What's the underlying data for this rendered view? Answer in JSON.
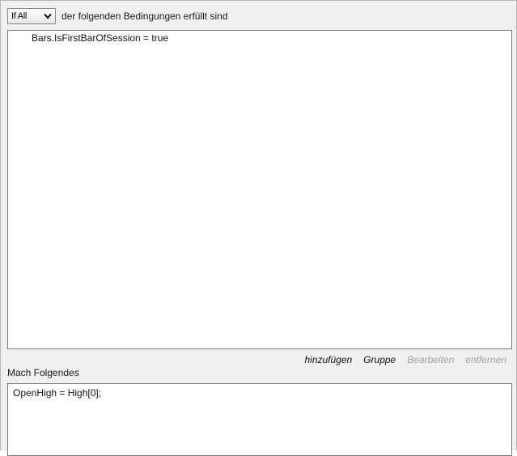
{
  "condition_header": {
    "mode_select": {
      "selected": "If All",
      "icon": "chevron-down-icon"
    },
    "label": "der folgenden Bedingungen erfüllt sind"
  },
  "conditions": [
    {
      "text": "Bars.IsFirstBarOfSession = true"
    }
  ],
  "action_bar": {
    "add": {
      "label": "hinzufügen",
      "enabled": true
    },
    "group": {
      "label": "Gruppe",
      "enabled": true
    },
    "edit": {
      "label": "Bearbeiten",
      "enabled": false
    },
    "remove": {
      "label": "entfernen",
      "enabled": false
    }
  },
  "actions_section": {
    "label": "Mach Folgendes",
    "lines": [
      {
        "text": "OpenHigh = High[0];"
      }
    ]
  },
  "colors": {
    "panel_background": "#f0f0f0",
    "editor_background": "#ffffff",
    "border": "#7a7a7a",
    "disabled_text": "#a0a0a0"
  }
}
